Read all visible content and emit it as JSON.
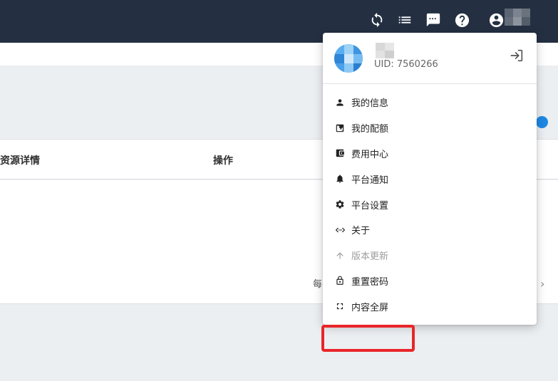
{
  "topbar": {
    "icons": [
      "sync-icon",
      "list-icon",
      "message-icon",
      "help-icon",
      "account-icon"
    ],
    "colors": {
      "background": "#243042",
      "icon": "#ffffff"
    }
  },
  "table": {
    "col_detail": "资源详情",
    "col_action": "操作"
  },
  "pagination": {
    "label_partial": "每",
    "next_icon": "chevron-right-icon"
  },
  "user_menu": {
    "uid": "UID: 7560266",
    "items": [
      {
        "label": "我的信息",
        "icon": "person-icon"
      },
      {
        "label": "我的配额",
        "icon": "quota-icon"
      },
      {
        "label": "费用中心",
        "icon": "wallet-icon"
      },
      {
        "label": "平台通知",
        "icon": "bell-icon"
      },
      {
        "label": "平台设置",
        "icon": "gear-icon"
      },
      {
        "label": "关于",
        "icon": "code-icon"
      },
      {
        "label": "版本更新",
        "icon": "arrow-up-icon",
        "disabled": true
      },
      {
        "label": "重置密码",
        "icon": "lock-icon",
        "highlighted": true
      },
      {
        "label": "内容全屏",
        "icon": "fullscreen-icon"
      }
    ],
    "highlight_color": "#e8262a"
  }
}
